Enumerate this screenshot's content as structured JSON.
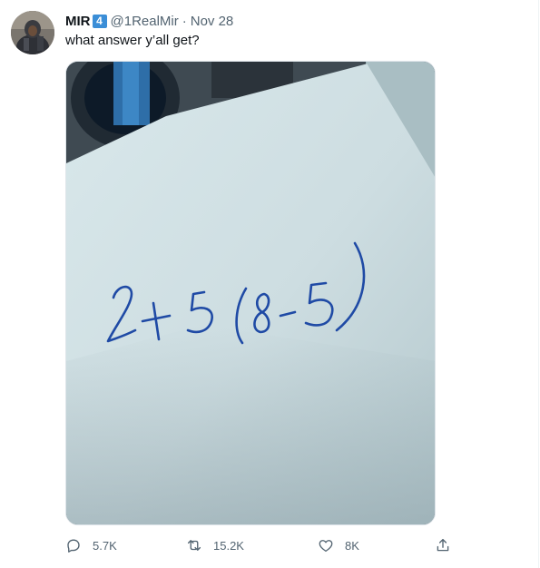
{
  "tweet": {
    "author_name": "MIR",
    "author_badge": "4",
    "handle": "@1RealMir",
    "separator": "·",
    "date": "Nov 28",
    "text": "what answer y’all get?",
    "media": {
      "handwriting": "2+5(8-5)",
      "ink_color": "#1f4aa5",
      "paper_color": "#cfdfe3"
    },
    "actions": {
      "reply_count": "5.7K",
      "retweet_count": "15.2K",
      "like_count": "8K"
    }
  },
  "icons": [
    "reply-icon",
    "retweet-icon",
    "like-icon",
    "share-icon"
  ],
  "colors": {
    "secondary_text": "#536471",
    "badge": "#3b8ed7"
  }
}
